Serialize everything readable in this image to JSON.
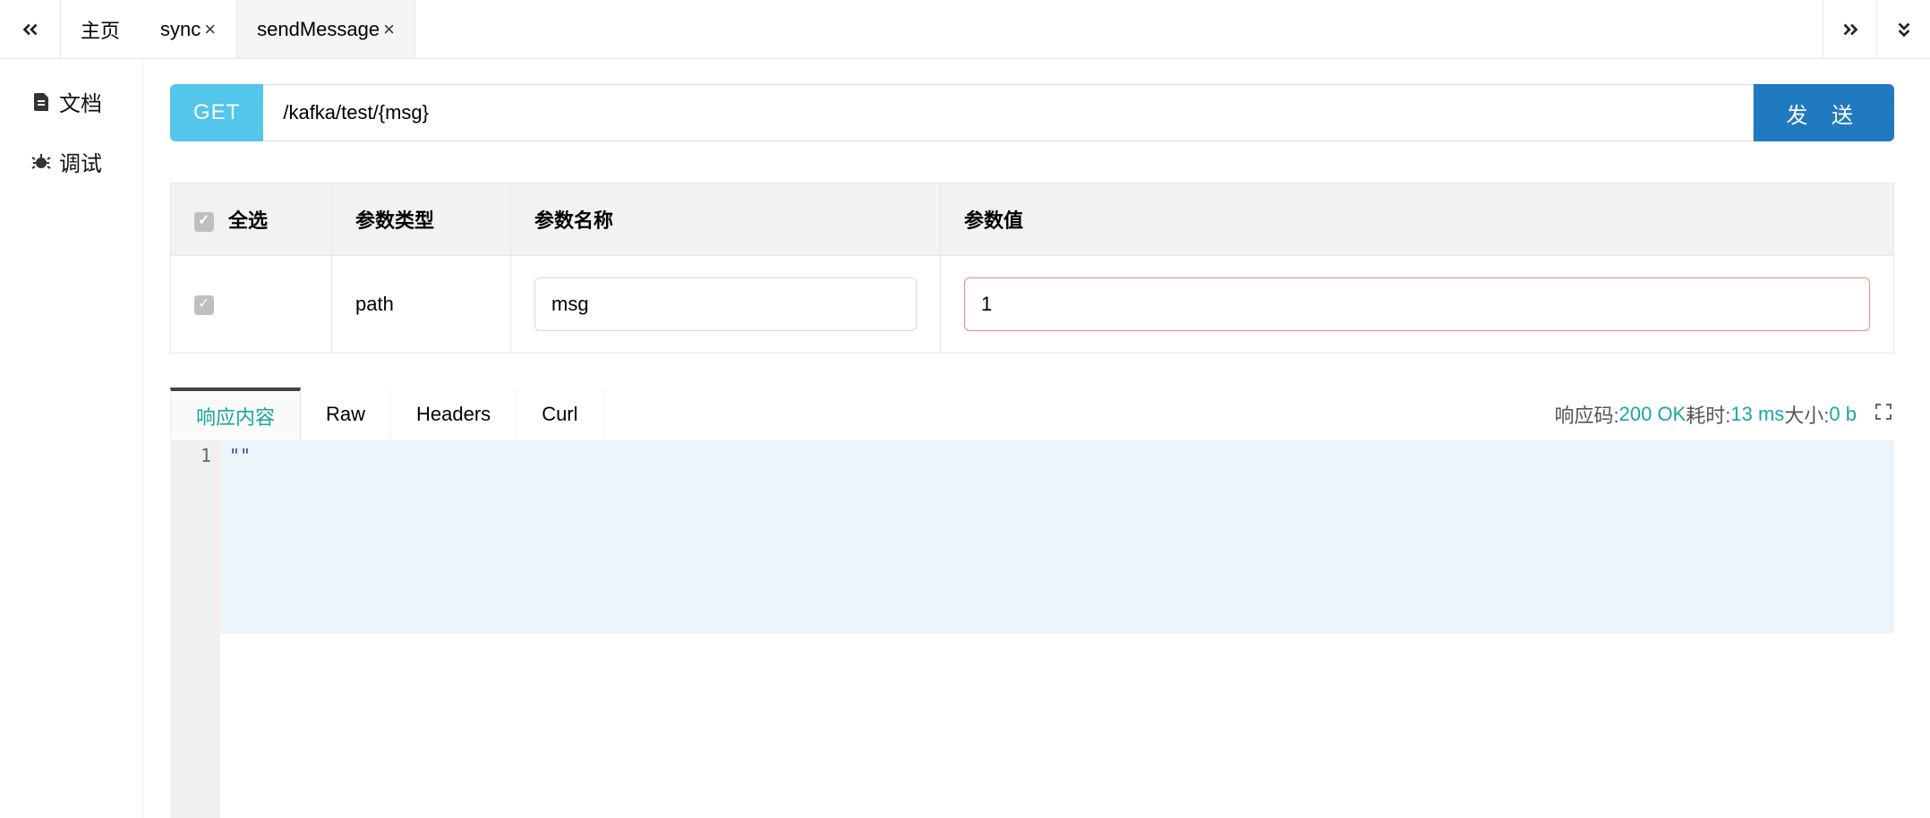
{
  "tabs": {
    "items": [
      {
        "label": "主页",
        "closable": false
      },
      {
        "label": "sync",
        "closable": true
      },
      {
        "label": "sendMessage",
        "closable": true,
        "active": true
      }
    ]
  },
  "sidebar": {
    "items": [
      {
        "label": "文档",
        "icon": "file-icon"
      },
      {
        "label": "调试",
        "icon": "bug-icon",
        "active": true
      }
    ]
  },
  "request": {
    "method": "GET",
    "url": "/kafka/test/{msg}",
    "send_label": "发 送"
  },
  "params": {
    "headers": {
      "select_all": "全选",
      "type": "参数类型",
      "name": "参数名称",
      "value": "参数值"
    },
    "rows": [
      {
        "checked": true,
        "type": "path",
        "name": "msg",
        "value": "1"
      }
    ]
  },
  "response": {
    "tabs": [
      {
        "label": "响应内容",
        "active": true
      },
      {
        "label": "Raw"
      },
      {
        "label": "Headers"
      },
      {
        "label": "Curl"
      }
    ],
    "meta": {
      "code_label": "响应码:",
      "code_value": "200 OK",
      "time_label": "耗时:",
      "time_value": "13 ms",
      "size_label": "大小:",
      "size_value": "0 b"
    },
    "body": {
      "line_no": "1",
      "content": "\"\""
    }
  }
}
